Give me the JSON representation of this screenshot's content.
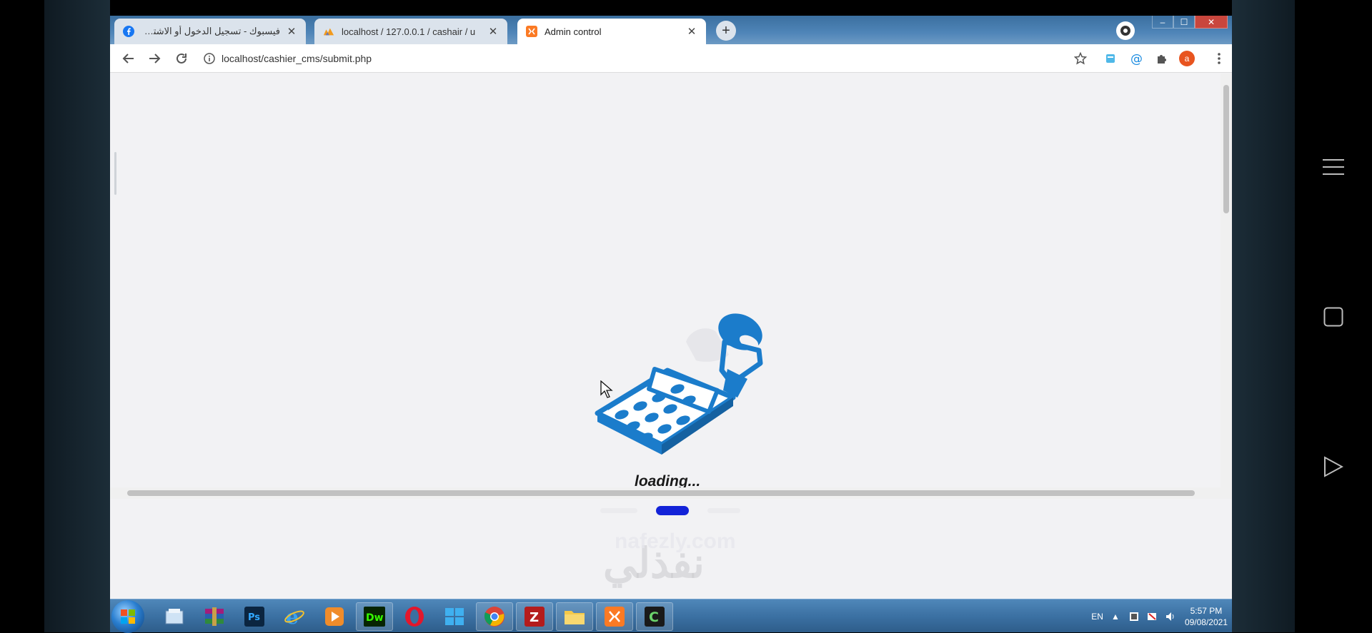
{
  "browser": {
    "tabs": [
      {
        "title": "فيسبوك - تسجيل الدخول أو الاشتراك",
        "favicon": "facebook-icon",
        "active": false
      },
      {
        "title": "localhost / 127.0.0.1 / cashair / u",
        "favicon": "phpmyadmin-icon",
        "active": false
      },
      {
        "title": "Admin control",
        "favicon": "xampp-icon",
        "active": true
      }
    ],
    "new_tab_symbol": "+",
    "url": "localhost/cashier_cms/submit.php",
    "profile_initial": "a",
    "window_controls": {
      "minimize": "–",
      "maximize": "☐",
      "close": "✕"
    }
  },
  "page": {
    "loading_text": "loading...",
    "loading_progress": 0.33,
    "illustration": "calculator-with-receipt",
    "accent_color": "#1b7ccb",
    "bar_color": "#1323d8"
  },
  "watermark": {
    "arabic": "نفذلي",
    "latin": "nafezly.com"
  },
  "taskbar": {
    "apps": [
      "start-orb",
      "file-explorer",
      "winrar",
      "photoshop",
      "internet-explorer",
      "media-player",
      "dreamweaver",
      "opera",
      "windows-store",
      "chrome",
      "filezilla",
      "folder",
      "xampp",
      "camtasia"
    ],
    "language": "EN",
    "time": "5:57 PM",
    "date": "09/08/2021"
  },
  "phone_nav": [
    "menu-icon",
    "home-square-icon",
    "back-triangle-icon"
  ]
}
